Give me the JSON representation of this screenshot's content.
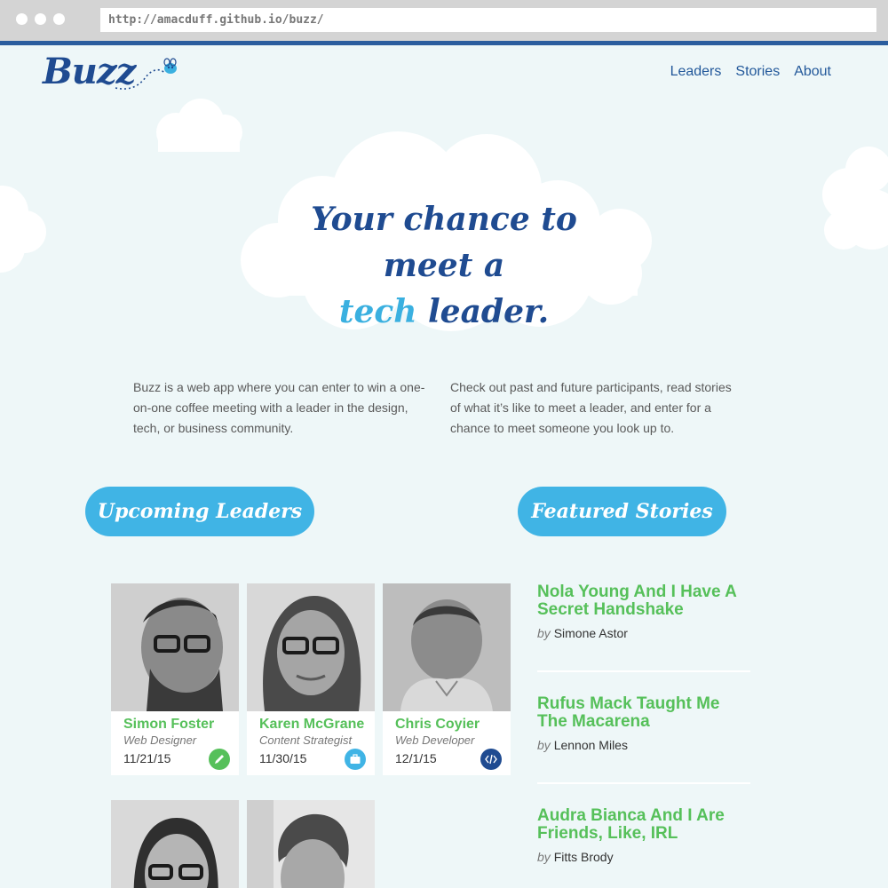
{
  "browser": {
    "url": "http://amacduff.github.io/buzz/"
  },
  "header": {
    "logo_text": "Buzz",
    "nav": [
      "Leaders",
      "Stories",
      "About"
    ]
  },
  "hero": {
    "line1": "Your chance to meet a",
    "accent_word": "tech",
    "line2_rest": "leader."
  },
  "intro": {
    "left": "Buzz is a web app where you can enter to win a one-on-one coffee meeting with a leader in the design, tech, or business community.",
    "right": "Check out past and future participants, read stories of what it’s like to meet a leader, and enter for a chance to meet someone you look up to."
  },
  "sections": {
    "leaders_label": "Upcoming Leaders",
    "stories_label": "Featured Stories"
  },
  "leaders": [
    {
      "name": "Simon Foster",
      "role": "Web Designer",
      "date": "11/21/15",
      "icon": "pencil-icon",
      "icon_color": "#56c05a"
    },
    {
      "name": "Karen McGrane",
      "role": "Content Strategist",
      "date": "11/30/15",
      "icon": "briefcase-icon",
      "icon_color": "#40b4e5"
    },
    {
      "name": "Chris Coyier",
      "role": "Web Developer",
      "date": "12/1/15",
      "icon": "code-icon",
      "icon_color": "#1f4b91"
    }
  ],
  "stories": [
    {
      "title": "Nola Young And I Have A Secret Handshake",
      "by": "by",
      "author": "Simone Astor"
    },
    {
      "title": "Rufus Mack Taught Me The Macarena",
      "by": "by",
      "author": "Lennon Miles"
    },
    {
      "title": "Audra Bianca And I Are Friends, Like, IRL",
      "by": "by",
      "author": "Fitts Brody"
    }
  ],
  "colors": {
    "background": "#eef7f8",
    "brand_blue": "#1f4b91",
    "accent_blue": "#40b4e5",
    "green": "#56c05a"
  }
}
